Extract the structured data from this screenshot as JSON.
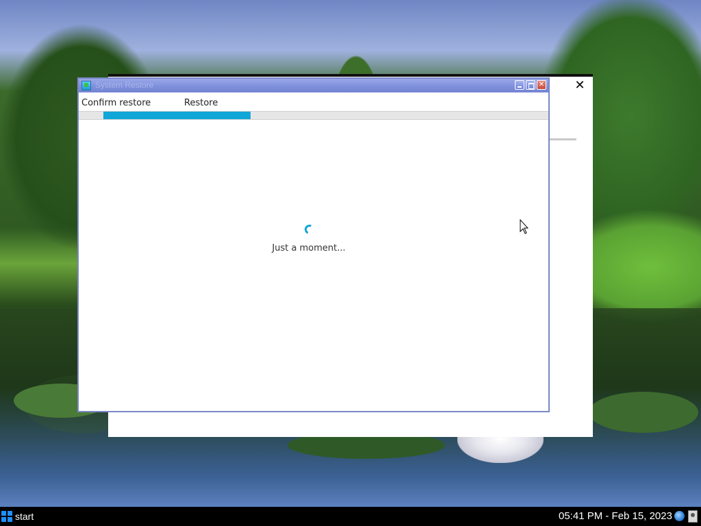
{
  "back_window": {
    "close_glyph": "✕"
  },
  "window": {
    "title": "System Restore",
    "icon": "restore-app-icon",
    "buttons": {
      "minimize_icon": "minimize-icon",
      "maximize_icon": "maximize-icon",
      "close_glyph": "✕"
    },
    "steps": [
      {
        "label": "Confirm restore"
      },
      {
        "label": "Restore"
      }
    ],
    "progress": {
      "fraction": 0.33,
      "color": "#10a6d8"
    },
    "loading_text": "Just a moment..."
  },
  "taskbar": {
    "start_label": "start",
    "clock": "05:41 PM - Feb 15, 2023",
    "tray_icons": [
      "globe-icon",
      "user-icon"
    ]
  }
}
